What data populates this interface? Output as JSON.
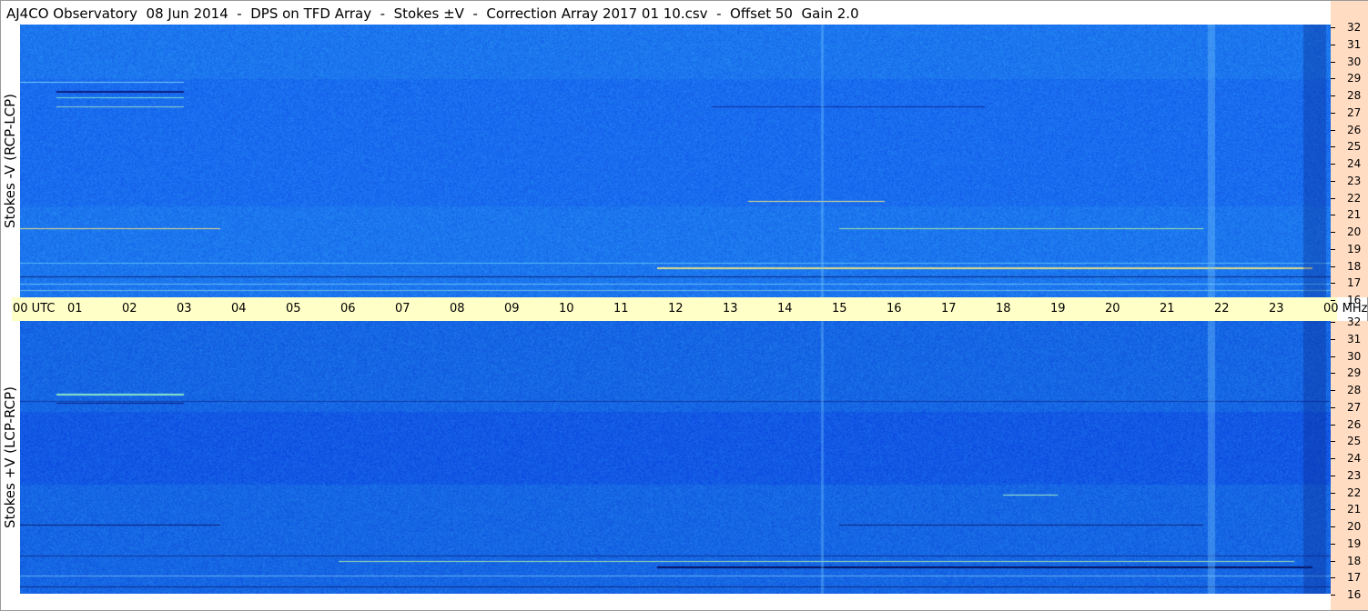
{
  "title": "AJ4CO Observatory  08 Jun 2014  -  DPS on TFD Array  -  Stokes ±V  -  Correction Array 2017 01 10.csv  -  Offset 50  Gain 2.0",
  "panels": {
    "top": {
      "ylabel": "Stokes -V (RCP-LCP)"
    },
    "bottom": {
      "ylabel": "Stokes +V (LCP-RCP)"
    }
  },
  "time_axis": {
    "ticks": [
      "00  UTC",
      "01",
      "02",
      "03",
      "04",
      "05",
      "06",
      "07",
      "08",
      "09",
      "10",
      "11",
      "12",
      "13",
      "14",
      "15",
      "16",
      "17",
      "18",
      "19",
      "20",
      "21",
      "22",
      "23",
      "00 MHz"
    ]
  },
  "freq_axis": {
    "unit": "MHz",
    "ticks": [
      "32",
      "31",
      "30",
      "29",
      "28",
      "27",
      "26",
      "25",
      "24",
      "23",
      "22",
      "21",
      "20",
      "19",
      "18",
      "17",
      "16"
    ]
  },
  "colors": {
    "background_blue": "#1e72f0",
    "time_axis_bg": "#ffffc8",
    "freq_axis_bg": "#ffdcc2"
  }
}
